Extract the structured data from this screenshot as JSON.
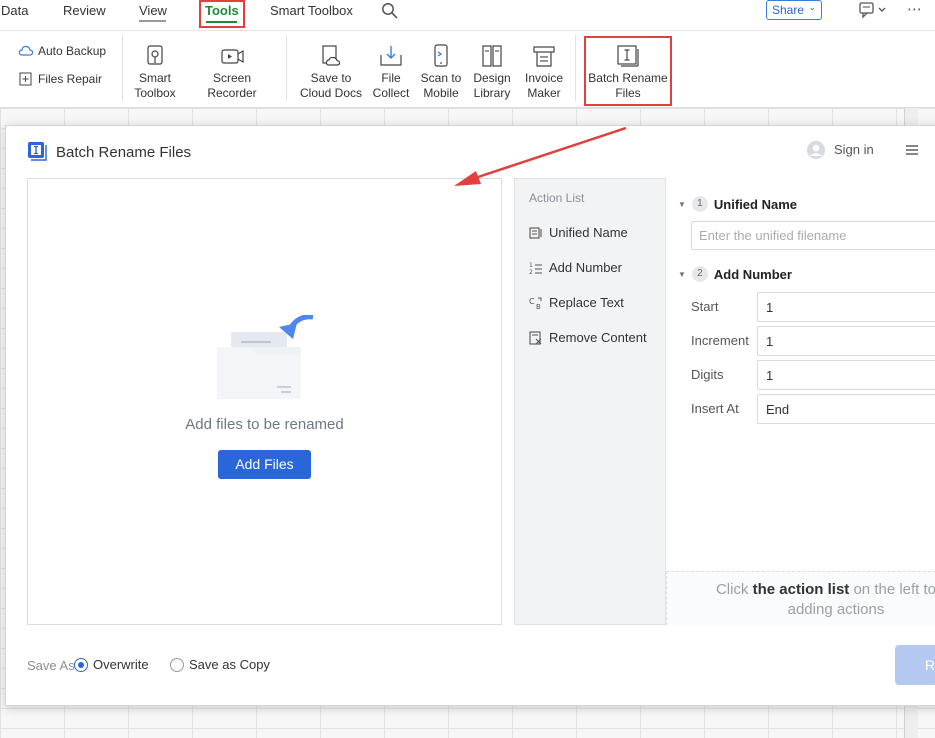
{
  "menubar": {
    "items": [
      "Data",
      "Review",
      "View",
      "Tools",
      "Smart Toolbox"
    ],
    "share_label": "Share"
  },
  "ribbon": {
    "auto_backup": "Auto Backup",
    "files_repair": "Files Repair",
    "smart_toolbox": [
      "Smart",
      "Toolbox"
    ],
    "screen_recorder": "Screen Recorder",
    "save_to_cloud": [
      "Save to",
      "Cloud Docs"
    ],
    "file_collect": [
      "File",
      "Collect"
    ],
    "scan_to_mobile": [
      "Scan to",
      "Mobile"
    ],
    "design_library": [
      "Design",
      "Library"
    ],
    "invoice_maker": [
      "Invoice",
      "Maker"
    ],
    "batch_rename": [
      "Batch Rename",
      "Files"
    ]
  },
  "dialog": {
    "title": "Batch Rename Files",
    "sign_in": "Sign in",
    "drop_text": "Add files to be renamed",
    "add_files": "Add Files",
    "action_list": {
      "title": "Action List",
      "items": [
        "Unified Name",
        "Add Number",
        "Replace Text",
        "Remove Content"
      ]
    },
    "settings": {
      "unified": {
        "num": "1",
        "title": "Unified Name",
        "placeholder": "Enter the unified filename"
      },
      "add_number": {
        "num": "2",
        "title": "Add Number",
        "fields": [
          {
            "label": "Start",
            "value": "1"
          },
          {
            "label": "Increment",
            "value": "1"
          },
          {
            "label": "Digits",
            "value": "1"
          },
          {
            "label": "Insert At",
            "value": "End"
          }
        ]
      },
      "hint_prefix": "Click ",
      "hint_bold": "the action list",
      "hint_suffix": " on the left to co",
      "hint_line2": "adding actions"
    },
    "save_as": {
      "label": "Save As",
      "options": [
        "Overwrite",
        "Save as Copy"
      ],
      "selected": "Overwrite"
    },
    "rename_button": "Re"
  },
  "colors": {
    "accent": "#2966d9",
    "highlight_red": "#e0413c",
    "tools_green": "#1f8a3a"
  }
}
